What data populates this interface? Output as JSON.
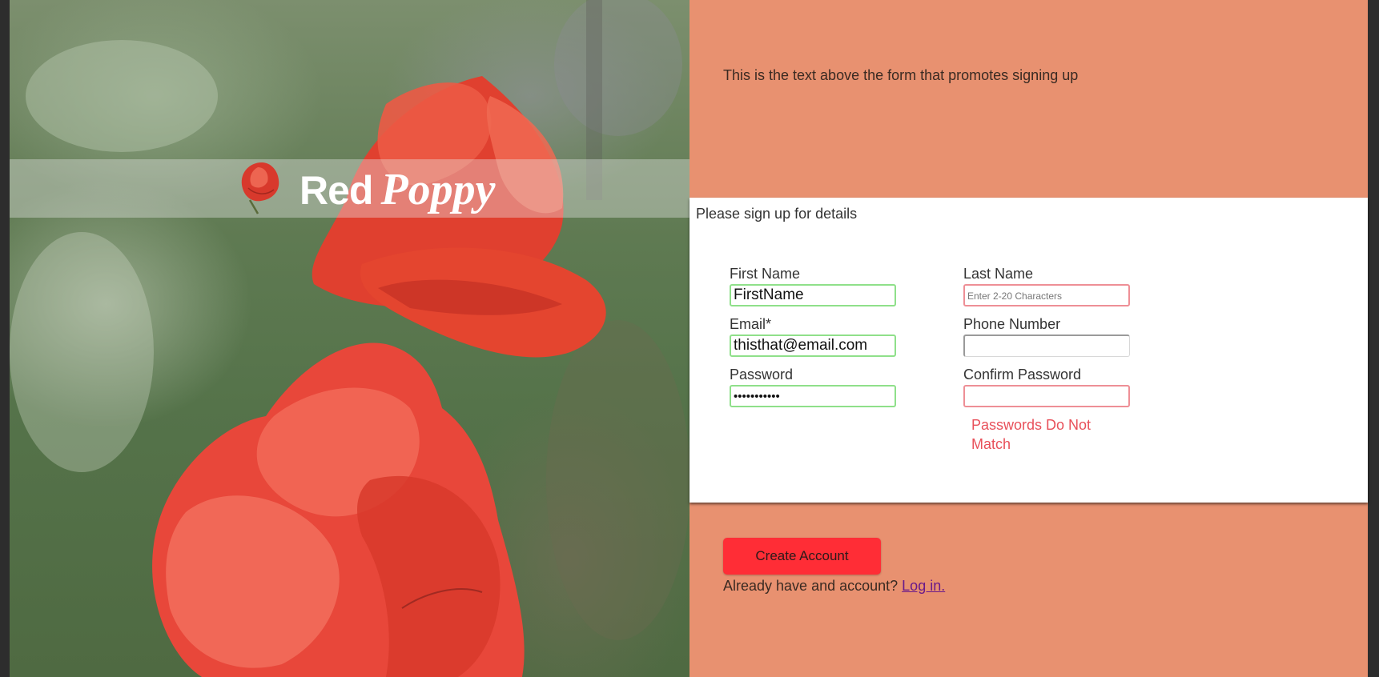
{
  "brand": {
    "name_part1": "Red",
    "name_part2": "Poppy"
  },
  "promo_text": "This is the text above the form that promotes signing up",
  "form": {
    "title": "Please sign up for details",
    "first_name": {
      "label": "First Name",
      "value": "FirstName",
      "status": "valid"
    },
    "last_name": {
      "label": "Last Name",
      "value": "",
      "placeholder": "Enter 2-20 Characters",
      "status": "invalid"
    },
    "email": {
      "label": "Email*",
      "value": "thisthat@email.com",
      "status": "valid"
    },
    "phone": {
      "label": "Phone Number",
      "value": "",
      "status": "neutral"
    },
    "password": {
      "label": "Password",
      "value": "•••••••••••",
      "status": "valid"
    },
    "confirm_password": {
      "label": "Confirm Password",
      "value": "",
      "status": "invalid"
    },
    "error": "Passwords Do Not Match"
  },
  "create_button_label": "Create Account",
  "login_prompt": "Already have and account?",
  "login_link": "Log in.",
  "colors": {
    "panel_bg": "#e89170",
    "button_bg": "#ff2d36",
    "error_text": "#e8505a",
    "valid_border": "#8fe08a",
    "invalid_border": "#ee8f96",
    "link": "#6a1a8a"
  },
  "icons": {
    "logo": "poppy-flower-icon"
  }
}
